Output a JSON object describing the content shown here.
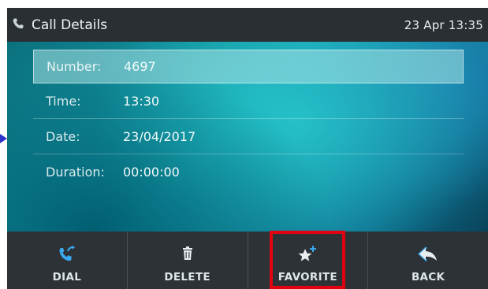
{
  "header": {
    "title": "Call Details",
    "datetime": "23 Apr 13:35",
    "icon": "phone-handset-icon"
  },
  "details": [
    {
      "label": "Number:",
      "value": "4697",
      "selected": true
    },
    {
      "label": "Time:",
      "value": "13:30",
      "selected": false
    },
    {
      "label": "Date:",
      "value": "23/04/2017",
      "selected": false
    },
    {
      "label": "Duration:",
      "value": "00:00:00",
      "selected": false
    }
  ],
  "softkeys": [
    {
      "label": "DIAL",
      "icon": "dial-call-icon"
    },
    {
      "label": "DELETE",
      "icon": "trash-icon"
    },
    {
      "label": "FAVORITE",
      "icon": "star-plus-icon"
    },
    {
      "label": "BACK",
      "icon": "back-arrow-icon"
    }
  ],
  "colors": {
    "header_bg": "#2a2f33",
    "softkey_bg": "#2c3236",
    "accent_blue": "#36a6ea",
    "highlight_red": "#e3000f",
    "pointer_blue": "#2b33c9"
  }
}
